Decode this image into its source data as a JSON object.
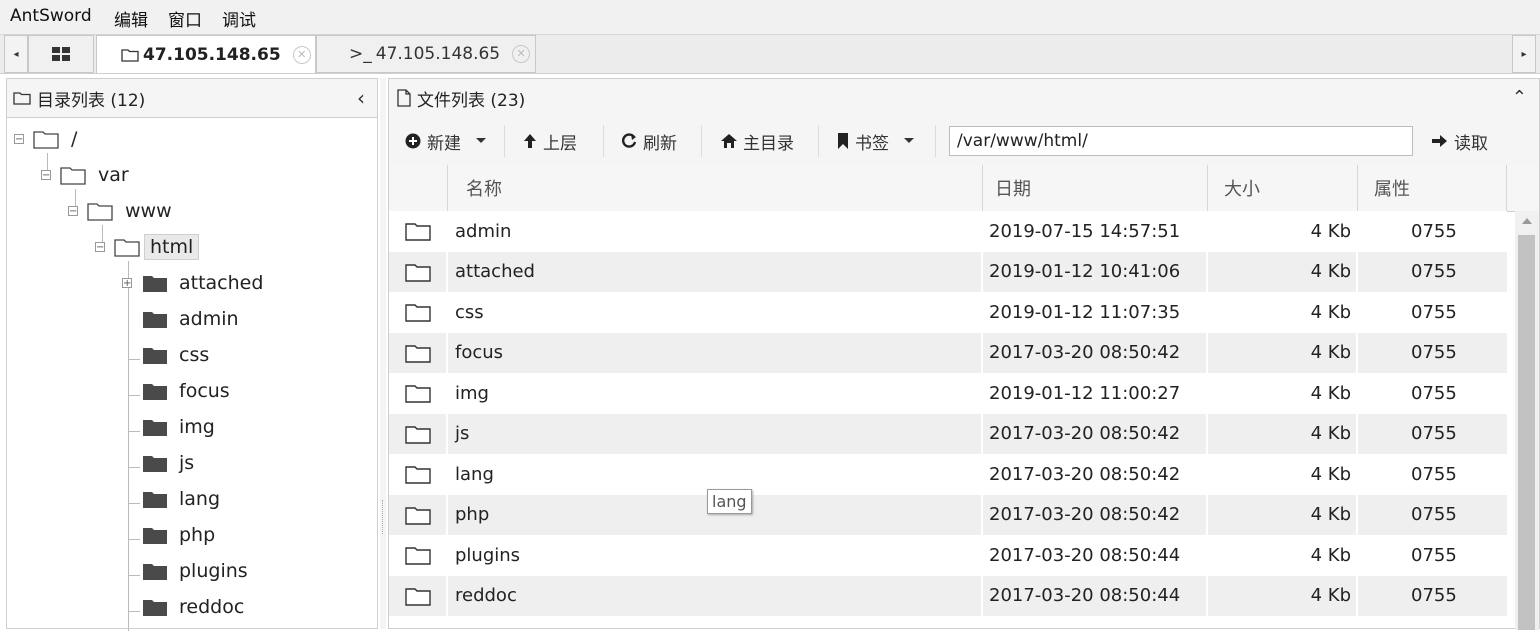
{
  "menubar": {
    "items": [
      "AntSword",
      "编辑",
      "窗口",
      "调试"
    ]
  },
  "tabs": {
    "scroll_left": "◂",
    "scroll_right": "▸",
    "home_icon": "grid-icon",
    "items": [
      {
        "label": "47.105.148.65",
        "icon": "folder-icon",
        "active": true
      },
      {
        "label": "47.105.148.65",
        "icon": "terminal-icon",
        "prefix": ">_",
        "active": false
      }
    ],
    "close_glyph": "✕"
  },
  "dir_panel": {
    "title": "目录列表 (12)",
    "collapse_glyph": "‹",
    "tree": [
      {
        "label": "/",
        "expanded": true,
        "selected": false
      },
      {
        "label": "var",
        "expanded": true,
        "selected": false
      },
      {
        "label": "www",
        "expanded": true,
        "selected": false
      },
      {
        "label": "html",
        "expanded": true,
        "selected": true
      },
      {
        "label": "attached",
        "expandable": true
      },
      {
        "label": "admin"
      },
      {
        "label": "css"
      },
      {
        "label": "focus"
      },
      {
        "label": "img"
      },
      {
        "label": "js"
      },
      {
        "label": "lang"
      },
      {
        "label": "php"
      },
      {
        "label": "plugins"
      },
      {
        "label": "reddoc"
      }
    ]
  },
  "file_panel": {
    "title": "文件列表 (23)",
    "collapse_glyph": "⌃",
    "toolbar": {
      "new_label": "新建",
      "up_label": "上层",
      "refresh_label": "刷新",
      "home_label": "主目录",
      "bookmark_label": "书签",
      "path_value": "/var/www/html/",
      "read_label": "读取"
    },
    "columns": [
      "名称",
      "日期",
      "大小",
      "属性"
    ],
    "rows": [
      {
        "name": "admin",
        "date": "2019-07-15 14:57:51",
        "size": "4 Kb",
        "perm": "0755"
      },
      {
        "name": "attached",
        "date": "2019-01-12 10:41:06",
        "size": "4 Kb",
        "perm": "0755"
      },
      {
        "name": "css",
        "date": "2019-01-12 11:07:35",
        "size": "4 Kb",
        "perm": "0755"
      },
      {
        "name": "focus",
        "date": "2017-03-20 08:50:42",
        "size": "4 Kb",
        "perm": "0755"
      },
      {
        "name": "img",
        "date": "2019-01-12 11:00:27",
        "size": "4 Kb",
        "perm": "0755"
      },
      {
        "name": "js",
        "date": "2017-03-20 08:50:42",
        "size": "4 Kb",
        "perm": "0755"
      },
      {
        "name": "lang",
        "date": "2017-03-20 08:50:42",
        "size": "4 Kb",
        "perm": "0755"
      },
      {
        "name": "php",
        "date": "2017-03-20 08:50:42",
        "size": "4 Kb",
        "perm": "0755"
      },
      {
        "name": "plugins",
        "date": "2017-03-20 08:50:44",
        "size": "4 Kb",
        "perm": "0755"
      },
      {
        "name": "reddoc",
        "date": "2017-03-20 08:50:44",
        "size": "4 Kb",
        "perm": "0755"
      }
    ]
  },
  "tooltip": {
    "text": "lang"
  },
  "colors": {
    "row_alt": "#efefef",
    "header_bg": "#f5f5f5",
    "border": "#cfcfcf",
    "folder_dark": "#4a4a4a"
  }
}
